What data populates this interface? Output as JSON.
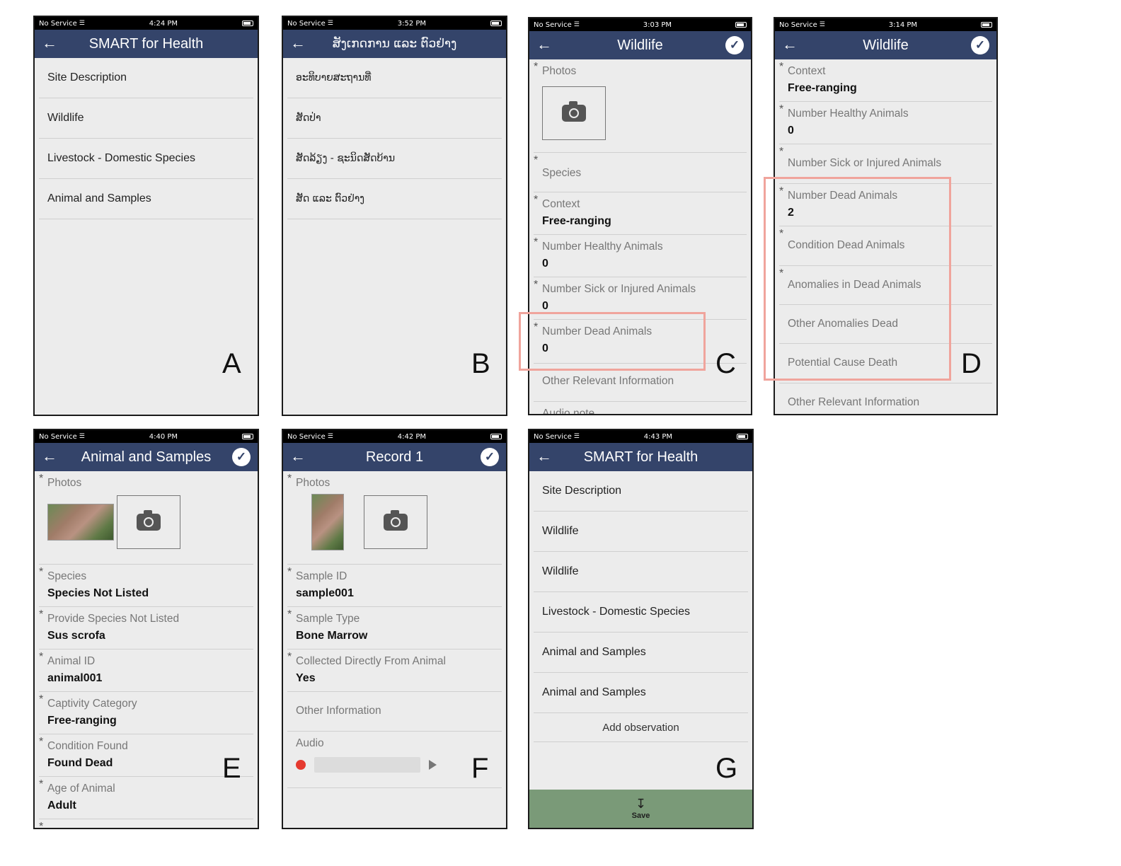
{
  "status": {
    "carrier": "No Service",
    "times": {
      "A": "4:24 PM",
      "B": "3:52 PM",
      "C": "3:03 PM",
      "D": "3:14 PM",
      "E": "4:40 PM",
      "F": "4:42 PM",
      "G": "4:43 PM"
    }
  },
  "colors": {
    "appbar": "#34446a",
    "highlight": "#f0a49c",
    "save_bar": "#7a9a78",
    "record_dot": "#e53a2f"
  },
  "icons": {
    "back": "arrow-left-icon",
    "check": "check-circle-icon",
    "camera": "camera-icon",
    "wifi": "wifi-icon",
    "battery": "battery-icon",
    "save": "download-icon"
  },
  "panelA": {
    "letter": "A",
    "title": "SMART for Health",
    "items": [
      "Site Description",
      "Wildlife",
      "Livestock - Domestic Species",
      "Animal and Samples"
    ]
  },
  "panelB": {
    "letter": "B",
    "title": "ສັງເກດການ ແລະ ຕົວຢ່າງ",
    "items": [
      "ອະທິບາຍສະຖານທີ່",
      "ສັດປ່າ",
      "ສັດລ້ຽງ - ຊະນິດສັດບ້ານ",
      "ສັດ ແລະ ຕົວຢ່າງ"
    ]
  },
  "panelC": {
    "letter": "C",
    "title": "Wildlife",
    "photos": "Photos",
    "species": "Species",
    "context": {
      "label": "Context",
      "value": "Free-ranging"
    },
    "healthy": {
      "label": "Number Healthy Animals",
      "value": "0"
    },
    "sick": {
      "label": "Number Sick or Injured Animals",
      "value": "0"
    },
    "dead": {
      "label": "Number Dead Animals",
      "value": "0"
    },
    "other": "Other Relevant Information",
    "audio": "Audio note"
  },
  "panelD": {
    "letter": "D",
    "title": "Wildlife",
    "context": {
      "label": "Context",
      "value": "Free-ranging"
    },
    "healthy": {
      "label": "Number Healthy Animals",
      "value": "0"
    },
    "sick": "Number Sick or Injured Animals",
    "dead": {
      "label": "Number Dead Animals",
      "value": "2"
    },
    "condition": "Condition Dead Animals",
    "anomalies": "Anomalies in Dead Animals",
    "other_anomalies": "Other Anomalies Dead",
    "cause": "Potential Cause Death",
    "other": "Other Relevant Information"
  },
  "panelE": {
    "letter": "E",
    "title": "Animal and Samples",
    "photos": "Photos",
    "species": {
      "label": "Species",
      "value": "Species Not Listed"
    },
    "provide": {
      "label": "Provide Species Not Listed",
      "value": "Sus scrofa"
    },
    "animal_id": {
      "label": "Animal ID",
      "value": "animal001"
    },
    "captivity": {
      "label": "Captivity Category",
      "value": "Free-ranging"
    },
    "condition": {
      "label": "Condition Found",
      "value": "Found Dead"
    },
    "age": {
      "label": "Age of Animal",
      "value": "Adult"
    }
  },
  "panelF": {
    "letter": "F",
    "title": "Record 1",
    "photos": "Photos",
    "sample_id": {
      "label": "Sample ID",
      "value": "sample001"
    },
    "sample_type": {
      "label": "Sample Type",
      "value": "Bone Marrow"
    },
    "collected": {
      "label": "Collected Directly From Animal",
      "value": "Yes"
    },
    "other": "Other Information",
    "audio": "Audio"
  },
  "panelG": {
    "letter": "G",
    "title": "SMART for Health",
    "items": [
      "Site Description",
      "Wildlife",
      "Wildlife",
      "Livestock - Domestic Species",
      "Animal and Samples",
      "Animal and Samples"
    ],
    "add": "Add observation",
    "save": "Save"
  }
}
